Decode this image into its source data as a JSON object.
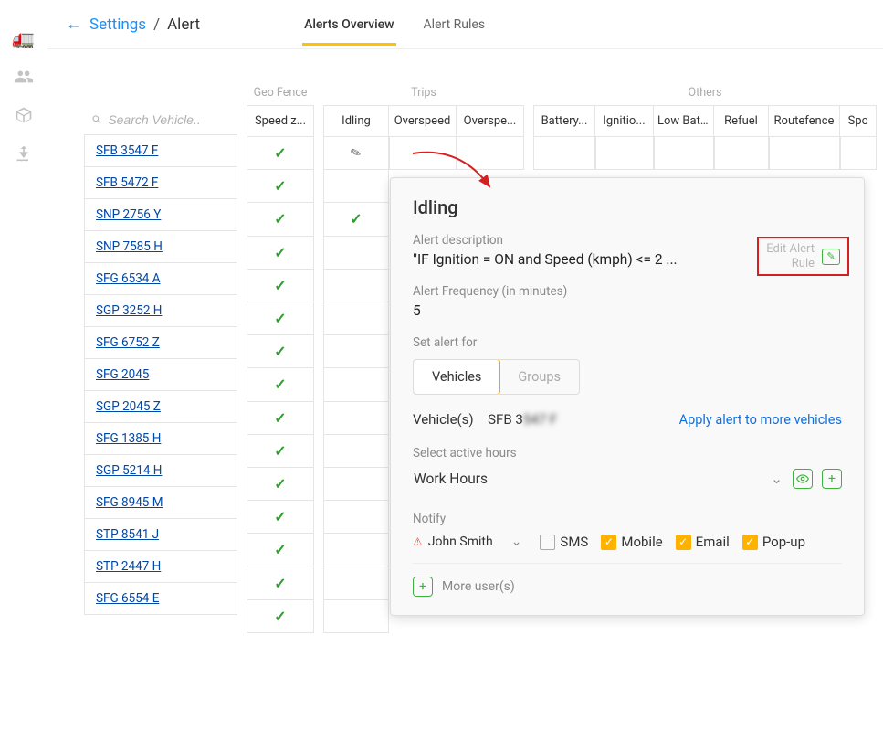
{
  "breadcrumb": {
    "back": "←",
    "settings": "Settings",
    "sep": "/",
    "current": "Alert"
  },
  "tabs": {
    "overview": "Alerts Overview",
    "rules": "Alert Rules"
  },
  "search": {
    "placeholder": "Search Vehicle.."
  },
  "groupHeaders": {
    "geofence": "Geo Fence",
    "trips": "Trips",
    "others": "Others"
  },
  "cols": {
    "speedz": "Speed z...",
    "idling": "Idling",
    "over1": "Overspeed",
    "over2": "Overspe...",
    "battery": "Battery...",
    "ignition": "Ignitio...",
    "lowbat": "Low Bat...",
    "refuel": "Refuel",
    "routefence": "Routefence",
    "spc": "Spc"
  },
  "vehicles": [
    "SFB 3547 F",
    "SFB 5472 F",
    "SNP 2756 Y",
    "SNP 7585 H",
    "SFG 6534 A",
    "SGP 3252 H",
    "SFG 6752 Z",
    "SFG 2045",
    "SGP 2045 Z",
    "SFG 1385 H",
    "SGP 5214 H",
    "SFG 8945 M",
    "STP 8541 J",
    "STP 2447 H",
    "SFG 6554 E"
  ],
  "panel": {
    "title": "Idling",
    "descLabel": "Alert description",
    "desc": "\"IF Ignition = ON and Speed (kmph) <= 2 ...",
    "editRule1": "Edit Alert",
    "editRule2": "Rule",
    "freqLabel": "Alert Frequency (in minutes)",
    "freq": "5",
    "setFor": "Set alert for",
    "segVehicles": "Vehicles",
    "segGroups": "Groups",
    "vehLabel": "Vehicle(s)",
    "vehValue": "SFB 3",
    "vehBlur": "547 F",
    "applyMore": "Apply alert to more vehicles",
    "hoursLabel": "Select active hours",
    "hoursValue": "Work Hours",
    "notify": "Notify",
    "user": "John Smith",
    "sms": "SMS",
    "mobile": "Mobile",
    "email": "Email",
    "popup": "Pop-up",
    "moreUsers": "More user(s)"
  }
}
